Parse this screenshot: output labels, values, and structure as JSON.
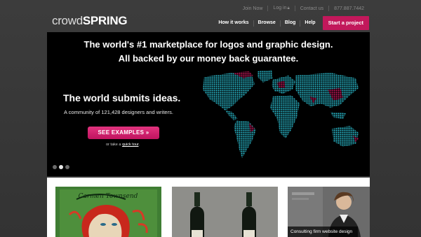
{
  "brand": {
    "logo_part1": "crowd",
    "logo_part2": "SPRING",
    "accent": "#c2185b"
  },
  "top_links": {
    "join": "Join Now",
    "login": "Log in",
    "login_icon": "lock-icon",
    "contact": "Contact us",
    "phone": "877.887.7442"
  },
  "nav": {
    "how": "How it works",
    "browse": "Browse",
    "blog": "Blog",
    "help": "Help",
    "start": "Start a project"
  },
  "hero": {
    "title_line1": "The world's #1 marketplace for logos and graphic design.",
    "title_line2": "All backed by our money back guarantee.",
    "submits": "The world submits ideas.",
    "community": "A community of 121,428 designers and writers.",
    "see_examples": "SEE EXAMPLES »",
    "tour_prefix": "or take a ",
    "tour_link": "quick tour",
    "tour_suffix": ".",
    "slides_total": 3,
    "slide_active": 2,
    "map_colors": [
      "#29b6c8",
      "#c2185b"
    ]
  },
  "portfolio": {
    "card1_text": "Carmen Townsend",
    "card3_caption": "Consulting firm website design"
  }
}
